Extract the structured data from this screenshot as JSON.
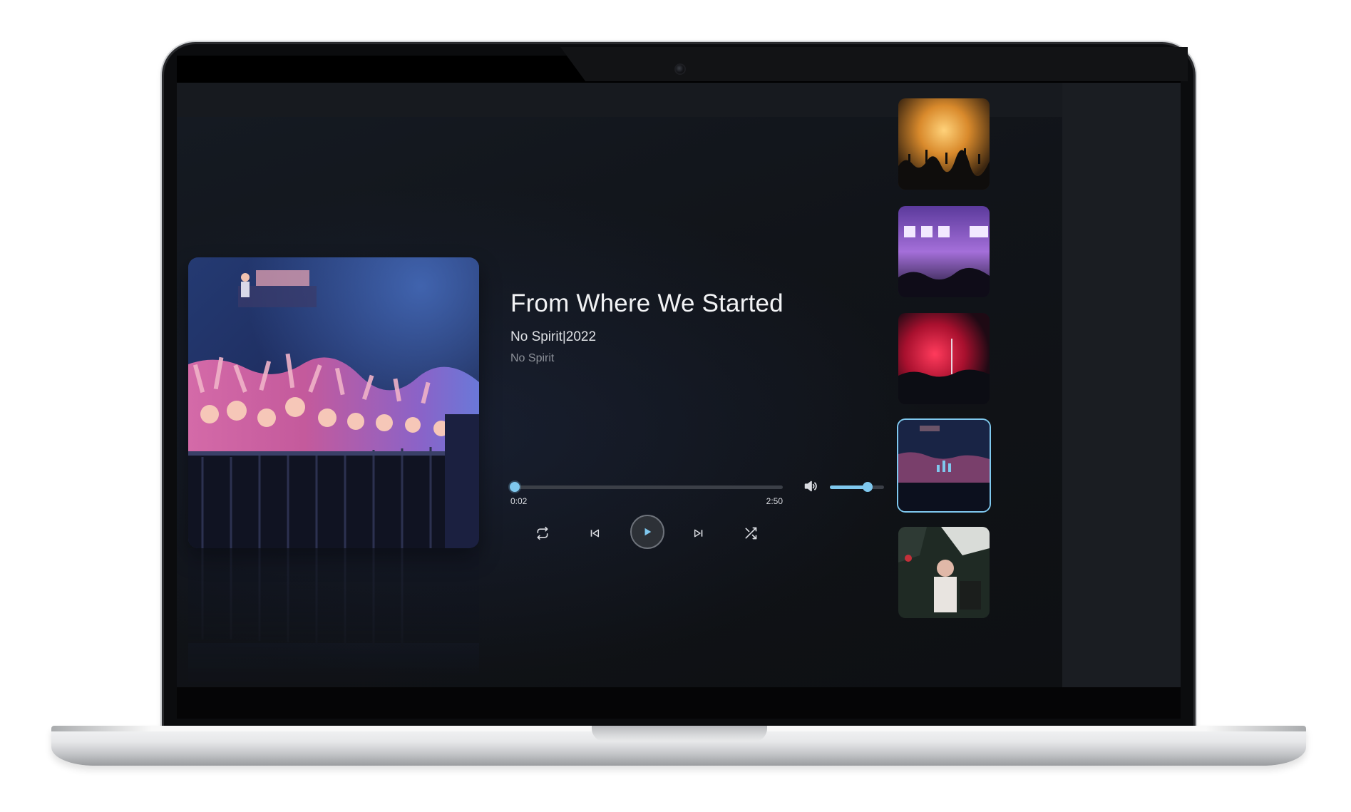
{
  "player": {
    "title": "From Where We Started",
    "album": "No Spirit",
    "separator": "|",
    "year": "2022",
    "artist": "No Spirit",
    "time_current": "0:02",
    "time_total": "2:50",
    "progress_fraction": 0.01,
    "volume_fraction": 0.7,
    "state": "paused"
  },
  "controls": {
    "repeat_icon": "repeat-icon",
    "previous_icon": "skip-previous-icon",
    "play_icon": "play-icon",
    "next_icon": "skip-next-icon",
    "shuffle_icon": "shuffle-icon",
    "volume_icon": "volume-icon"
  },
  "playlist": {
    "items": [
      {
        "name": "concert-orange-thumbnail",
        "active": false
      },
      {
        "name": "concert-purple-thumbnail",
        "active": false
      },
      {
        "name": "concert-red-thumbnail",
        "active": false
      },
      {
        "name": "crowd-blue-thumbnail",
        "active": true
      },
      {
        "name": "performer-thumbnail",
        "active": false
      }
    ],
    "active_indicator_icon": "equalizer-icon"
  },
  "colors": {
    "accent": "#7fc8ee",
    "background": "#13161b",
    "sidebar": "#1a1d22",
    "text_primary": "#f2f3f5",
    "text_secondary": "#8d9199"
  }
}
